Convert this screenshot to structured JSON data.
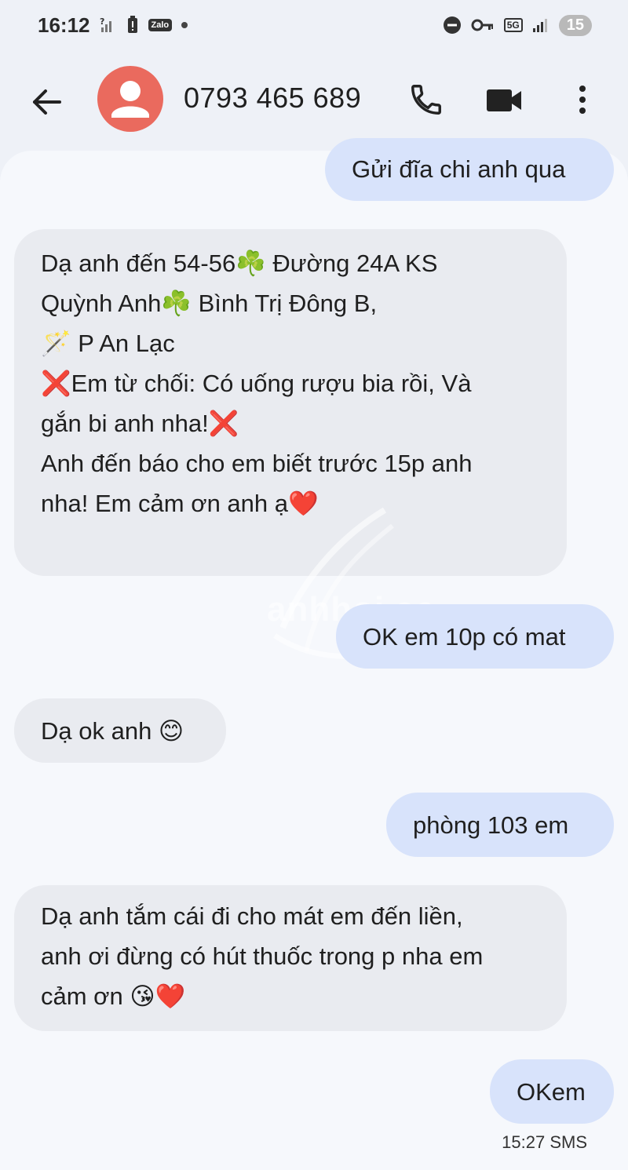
{
  "status_bar": {
    "time": "16:12",
    "zalo_label": "Zalo",
    "network_label": "5G",
    "battery_level": "15"
  },
  "header": {
    "contact": "0793 465 689"
  },
  "messages": [
    {
      "direction": "out",
      "lines": [
        "Gửi đĩa chi anh qua"
      ]
    },
    {
      "direction": "in",
      "lines": [
        "Dạ anh đến 54-56☘️ Đường 24A KS",
        "Quỳnh Anh☘️ Bình Trị Đông B,",
        "🪄 P An Lạc",
        "❌Em từ chối: Có uống rượu bia rồi, Và",
        "gắn bi anh nha!❌",
        "Anh đến báo cho em biết trước 15p anh",
        "nha! Em cảm ơn anh ạ❤️"
      ]
    },
    {
      "direction": "out",
      "lines": [
        "OK em 10p có mat"
      ]
    },
    {
      "direction": "in",
      "lines": [
        "Dạ ok anh 😊"
      ]
    },
    {
      "direction": "out",
      "lines": [
        "phòng 103 em"
      ]
    },
    {
      "direction": "in",
      "lines": [
        "Dạ anh tắm cái đi cho mát em đến liền,",
        "anh ơi đừng có hút thuốc trong p nha em",
        "cảm ơn 😘❤️"
      ]
    },
    {
      "direction": "out",
      "lines": [
        "OKem"
      ]
    }
  ],
  "last_message_meta": "15:27 SMS",
  "watermark": "anhhoi.ac",
  "colors": {
    "background": "#eef1f7",
    "outgoing_bubble": "#d8e3fb",
    "incoming_bubble": "#e9ebf0",
    "avatar": "#ea6a5e"
  }
}
